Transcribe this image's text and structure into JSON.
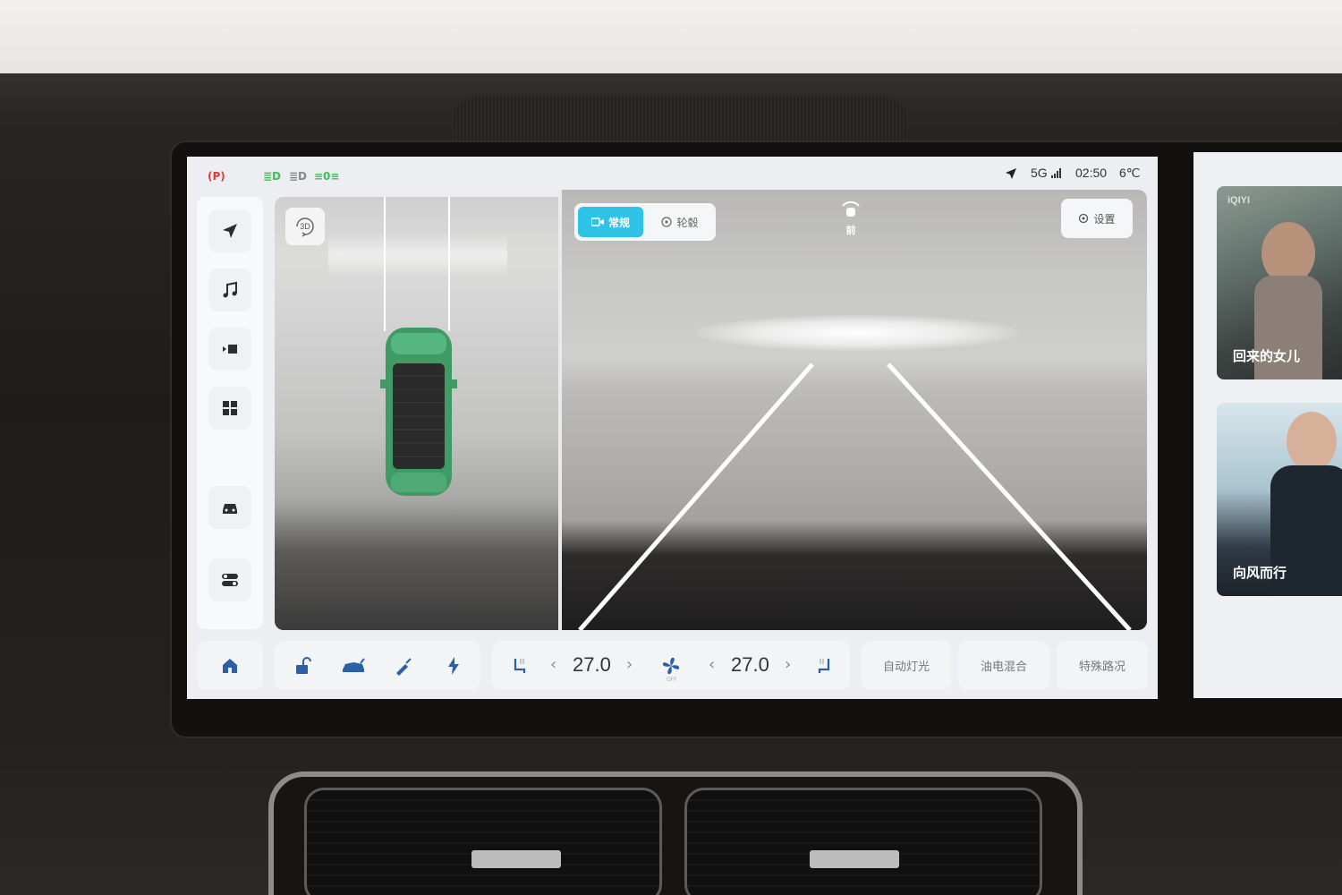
{
  "status_bar": {
    "indicators": [
      "parking-brake-icon",
      "low-beam-icon",
      "high-beam-icon",
      "position-light-icon"
    ],
    "network": "5G",
    "time": "02:50",
    "temperature": "6℃"
  },
  "sidebar": {
    "items": [
      "navigation-icon",
      "music-icon",
      "media-icon",
      "apps-icon",
      "car-icon",
      "settings-toggle-icon"
    ]
  },
  "camera": {
    "btn_3d": "3D",
    "view_normal": "常规",
    "view_wheel": "轮毂",
    "direction": "前",
    "settings": "设置"
  },
  "dock": {
    "climate": {
      "left_temp": "27.0",
      "right_temp": "27.0",
      "fan_state": "OFF"
    },
    "auto_light": "自动灯光",
    "hybrid_mode": "油电混合",
    "special_road": "特殊路况"
  },
  "side_screen": {
    "brand": "iQIYI",
    "cards": [
      {
        "title": "回来的女儿"
      },
      {
        "title": "向风而行"
      }
    ]
  },
  "colors": {
    "accent": "#2fc3e8",
    "screen_bg": "#eceef2",
    "green_indicator": "#3fbf5a",
    "red_indicator": "#e03a3a"
  }
}
